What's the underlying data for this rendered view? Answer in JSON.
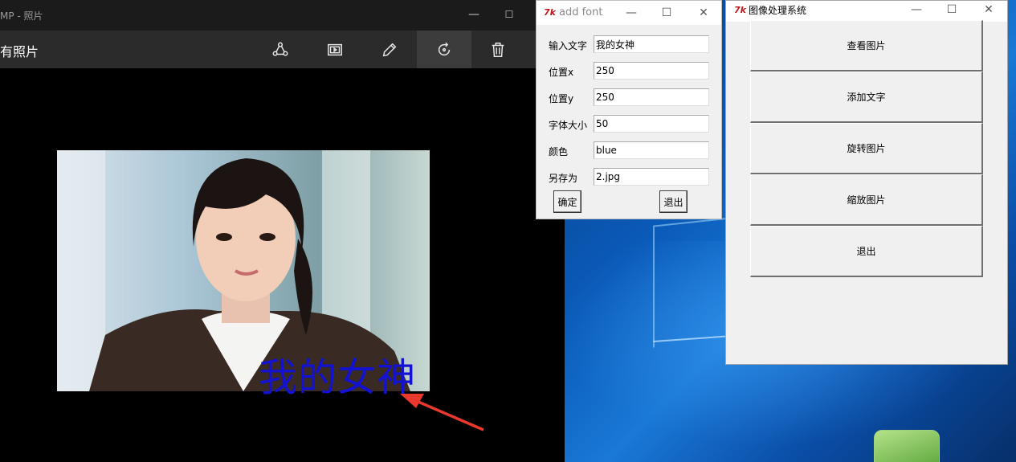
{
  "photos_app": {
    "title": "MP - 照片",
    "album_label": "有照片",
    "toolbar_icons": [
      "share-icon",
      "slideshow-icon",
      "edit-icon",
      "rotate-icon",
      "delete-icon"
    ],
    "photo_caption": "我的女神",
    "caption_color": "#1212d0"
  },
  "add_font_dialog": {
    "title": "add font",
    "fields": [
      {
        "label": "输入文字",
        "value": "我的女神"
      },
      {
        "label": "位置x",
        "value": "250"
      },
      {
        "label": "位置y",
        "value": "250"
      },
      {
        "label": "字体大小",
        "value": "50"
      },
      {
        "label": "颜色",
        "value": "blue"
      },
      {
        "label": "另存为",
        "value": "2.jpg"
      }
    ],
    "confirm_label": "确定",
    "exit_label": "退出"
  },
  "main_window": {
    "title": "图像处理系统",
    "buttons": [
      "查看图片",
      "添加文字",
      "旋转图片",
      "缩放图片",
      "退出"
    ]
  },
  "window_controls": {
    "minimize": "—",
    "maximize": "☐",
    "close": "✕"
  },
  "colors": {
    "desktop_blue": "#0a5ab8",
    "tk_icon_red": "#c0171b",
    "annotation_arrow": "#e8392c"
  }
}
